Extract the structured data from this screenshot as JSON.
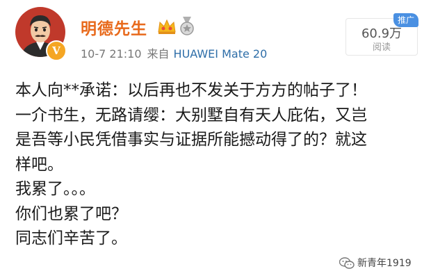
{
  "post": {
    "author": "明德先生",
    "time": "10-7 21:10",
    "source_label": "来自",
    "device": "HUAWEI Mate 20",
    "verified_badge": "V",
    "reads": {
      "count": "60.9万",
      "label": "阅读"
    },
    "promote_label": "推广",
    "lines": [
      "本人向**承诺：以后再也不发关于方方的帖子了！",
      "一介书生，无路请缨：大别墅自有天人庇佑，又岂",
      "是吾等小民凭借事实与证据所能撼动得了的？就这",
      "样吧。",
      "我累了。。。",
      "你们也累了吧？",
      "同志们辛苦了。"
    ]
  },
  "watermark": {
    "text": "新青年1919"
  },
  "colors": {
    "username": "#e86a1c",
    "device": "#2e6ea8",
    "badge": "#f5a623",
    "promote": "#4a90e2"
  }
}
